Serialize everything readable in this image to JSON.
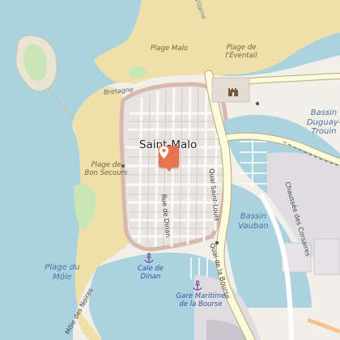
{
  "map": {
    "city_label": "Saint-Malo",
    "water_labels": {
      "bassin_duguay_trouin": "Bassin Duguay-Trouin",
      "bassin_vauban": "Bassin Vauban",
      "plage_du_mole": "Plage du Môle"
    },
    "beach_labels": {
      "plage_malo": "Plage Malo",
      "plage_eventail": "Plage de l'Éventail",
      "plage_bon_secours": "Plage de Bon Secours"
    },
    "street_labels": {
      "quai_saint_louis": "Quai Saint-Louis",
      "quai_de_la_bourse": "Quai de la Bourse",
      "rue_de_dinan": "Rue de Dinan",
      "chaussee_des_corsaires": "Chaussée des Corsaires",
      "bretagne": "Bretagne",
      "vilaine": "Vilaine",
      "mole_des_noires": "Môle des Noires"
    },
    "poi_labels": {
      "cale_de_dinan": "Cale de Dinan",
      "gare_maritime": "Gare Maritime de la Bourse"
    },
    "icons": [
      "location-pin-icon",
      "castle-icon",
      "anchor-icon"
    ],
    "colors": {
      "sea": "#aad3df",
      "land": "#f2efe9",
      "beach": "#f1dfa9",
      "pedestrian": "#f7f4f2",
      "highway": "#fdfbdc",
      "pin": "#e8734e",
      "harbor_area": "#dfdde0"
    }
  }
}
